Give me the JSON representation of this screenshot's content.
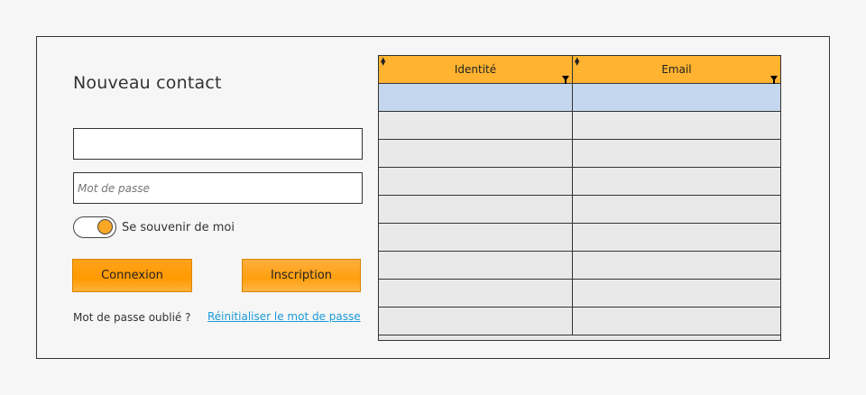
{
  "form": {
    "title": "Nouveau contact",
    "username": {
      "value": "",
      "placeholder": ""
    },
    "password": {
      "value": "",
      "placeholder": "Mot de passe"
    },
    "remember_label": "Se souvenir de moi",
    "remember_on": true,
    "login_label": "Connexion",
    "signup_label": "Inscription",
    "forgot_text": "Mot de passe oublié ?",
    "reset_link": "Réinitialiser le mot de passe"
  },
  "table": {
    "columns": [
      "Identité",
      "Email"
    ],
    "rows": [
      [
        "",
        ""
      ],
      [
        "",
        ""
      ],
      [
        "",
        ""
      ],
      [
        "",
        ""
      ],
      [
        "",
        ""
      ],
      [
        "",
        ""
      ],
      [
        "",
        ""
      ],
      [
        "",
        ""
      ],
      [
        "",
        ""
      ]
    ],
    "selected_row": 0
  },
  "colors": {
    "accent": "#ff9a00",
    "header": "#ffb330",
    "selected_row": "#c5d7ee",
    "link": "#1a9ad6"
  },
  "icons": {
    "sort": "sort-arrows-icon",
    "filter": "filter-funnel-icon",
    "toggle": "toggle-switch"
  }
}
